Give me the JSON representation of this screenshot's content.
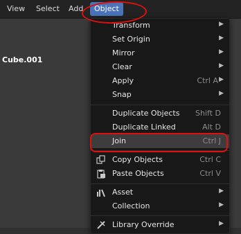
{
  "header": {
    "menus": [
      "View",
      "Select",
      "Add",
      "Object"
    ],
    "active_menu": "Object"
  },
  "viewport": {
    "object_name": "Cube.001"
  },
  "menu": {
    "items": [
      {
        "label": "Transform",
        "shortcut": "",
        "submenu": true
      },
      {
        "label": "Set Origin",
        "shortcut": "",
        "submenu": true
      },
      {
        "label": "Mirror",
        "shortcut": "",
        "submenu": true
      },
      {
        "label": "Clear",
        "shortcut": "",
        "submenu": true
      },
      {
        "label": "Apply",
        "shortcut": "Ctrl A",
        "submenu": true
      },
      {
        "label": "Snap",
        "shortcut": "",
        "submenu": true
      },
      {
        "label": "Duplicate Objects",
        "shortcut": "Shift D",
        "submenu": false
      },
      {
        "label": "Duplicate Linked",
        "shortcut": "Alt D",
        "submenu": false
      },
      {
        "label": "Join",
        "shortcut": "Ctrl J",
        "submenu": false
      },
      {
        "label": "Copy Objects",
        "shortcut": "Ctrl C",
        "submenu": false
      },
      {
        "label": "Paste Objects",
        "shortcut": "Ctrl V",
        "submenu": false
      },
      {
        "label": "Asset",
        "shortcut": "",
        "submenu": true
      },
      {
        "label": "Collection",
        "shortcut": "",
        "submenu": true
      },
      {
        "label": "Library Override",
        "shortcut": "",
        "submenu": true
      }
    ]
  },
  "annotation_color": "#e01010",
  "highlight_color": "#3d3d3d",
  "accent_color": "#4a73b8"
}
